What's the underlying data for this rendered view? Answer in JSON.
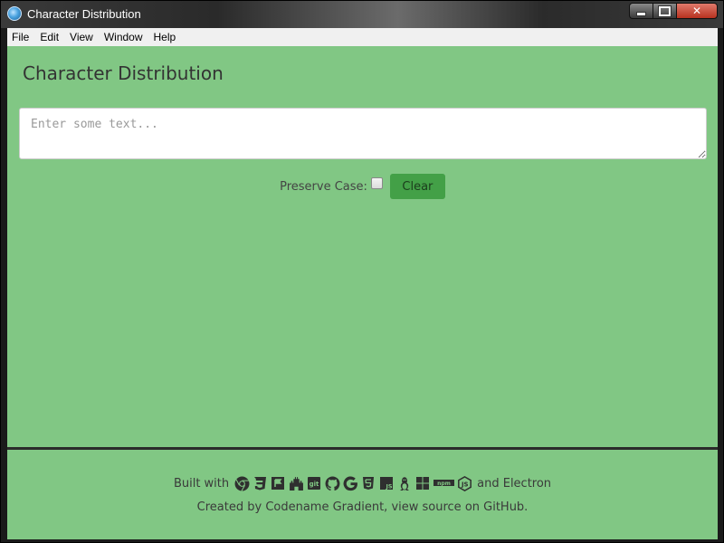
{
  "window": {
    "title": "Character Distribution",
    "controls": {
      "minimize": "minimize",
      "maximize": "maximize",
      "close": "✕"
    }
  },
  "menubar": {
    "items": [
      "File",
      "Edit",
      "View",
      "Window",
      "Help"
    ]
  },
  "app": {
    "heading": "Character Distribution",
    "input": {
      "placeholder": "Enter some text...",
      "value": ""
    },
    "preserve_case_label": "Preserve Case:",
    "preserve_case_checked": false,
    "clear_label": "Clear"
  },
  "footer": {
    "built_with": "Built with",
    "and_electron": "and Electron",
    "tech_icons": [
      "chrome-icon",
      "css3-icon",
      "flag-icon",
      "castle-icon",
      "git-icon",
      "github-icon",
      "google-icon",
      "html5-icon",
      "javascript-icon",
      "linux-icon",
      "windows-icon",
      "npm-icon",
      "nodejs-icon"
    ],
    "credit": "Created by Codename Gradient, view source on GitHub."
  },
  "colors": {
    "background": "#81c784",
    "button": "#43a047",
    "titlebar": "#2b2b2b"
  }
}
